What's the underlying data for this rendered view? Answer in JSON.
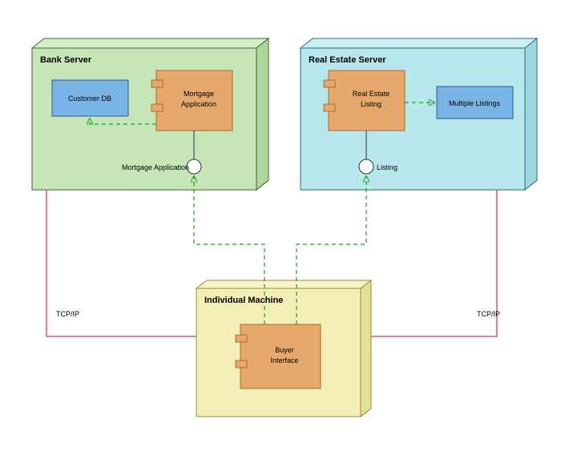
{
  "diagram": {
    "nodes": {
      "bank_server": {
        "title": "Bank Server"
      },
      "real_estate_server": {
        "title": "Real Estate Server"
      },
      "individual_machine": {
        "title": "Individual Machine"
      }
    },
    "components": {
      "customer_db": {
        "label": "Customer DB"
      },
      "mortgage_application": {
        "label": "Mortgage\nApplication"
      },
      "real_estate_listing": {
        "label": "Real Estate\nListing"
      },
      "multiple_listings": {
        "label": "Multiple Listings"
      },
      "buyer_interface": {
        "label": "Buyer\nInterface"
      }
    },
    "interfaces": {
      "mortgage_application_port": {
        "label": "Mortgage Application"
      },
      "listing_port": {
        "label": "Listing"
      }
    },
    "connections": {
      "tcpip_left": {
        "label": "TCP/IP"
      },
      "tcpip_right": {
        "label": "TCP/IP"
      }
    }
  },
  "chart_data": {
    "type": "uml-deployment",
    "nodes": [
      {
        "id": "bank_server",
        "name": "Bank Server",
        "type": "node",
        "components": [
          {
            "id": "customer_db",
            "name": "Customer DB",
            "stereotype": "artifact"
          },
          {
            "id": "mortgage_application",
            "name": "Mortgage Application",
            "stereotype": "component",
            "provided_interfaces": [
              "Mortgage Application"
            ]
          }
        ]
      },
      {
        "id": "real_estate_server",
        "name": "Real Estate Server",
        "type": "node",
        "components": [
          {
            "id": "real_estate_listing",
            "name": "Real Estate Listing",
            "stereotype": "component",
            "provided_interfaces": [
              "Listing"
            ]
          },
          {
            "id": "multiple_listings",
            "name": "Multiple Listings",
            "stereotype": "artifact"
          }
        ]
      },
      {
        "id": "individual_machine",
        "name": "Individual Machine",
        "type": "node",
        "components": [
          {
            "id": "buyer_interface",
            "name": "Buyer Interface",
            "stereotype": "component"
          }
        ]
      }
    ],
    "connections": [
      {
        "from": "mortgage_application",
        "to": "customer_db",
        "style": "dashed-arrow",
        "kind": "dependency"
      },
      {
        "from": "real_estate_listing",
        "to": "multiple_listings",
        "style": "dashed-arrow",
        "kind": "dependency"
      },
      {
        "from": "buyer_interface",
        "to_interface": "Mortgage Application",
        "style": "dashed",
        "kind": "interface-use"
      },
      {
        "from": "buyer_interface",
        "to_interface": "Listing",
        "style": "dashed",
        "kind": "interface-use"
      },
      {
        "from": "individual_machine",
        "to": "bank_server",
        "style": "solid",
        "label": "TCP/IP",
        "kind": "communication-path"
      },
      {
        "from": "individual_machine",
        "to": "real_estate_server",
        "style": "solid",
        "label": "TCP/IP",
        "kind": "communication-path"
      }
    ]
  }
}
